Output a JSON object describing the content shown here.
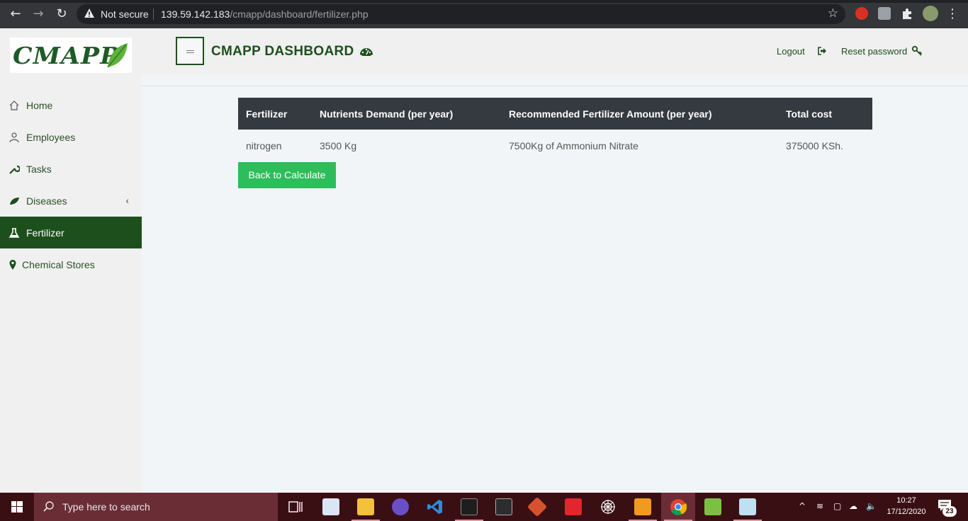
{
  "browser": {
    "security_label": "Not secure",
    "url_host": "139.59.142.183",
    "url_path": "/cmapp/dashboard/fertilizer.php"
  },
  "sidebar": {
    "logo_text": "CMAPP",
    "items": [
      {
        "label": "Home",
        "icon": "home-icon"
      },
      {
        "label": "Employees",
        "icon": "user-icon"
      },
      {
        "label": "Tasks",
        "icon": "wrench-icon"
      },
      {
        "label": "Diseases",
        "icon": "leaf-icon"
      },
      {
        "label": "Fertilizer",
        "icon": "flask-icon",
        "active": true
      },
      {
        "label": "Chemical Stores",
        "icon": "map-marker-icon"
      }
    ]
  },
  "header": {
    "title": "CMAPP DASHBOARD",
    "logout_label": "Logout",
    "reset_label": "Reset password"
  },
  "table": {
    "columns": [
      "Fertilizer",
      "Nutrients Demand (per year)",
      "Recommended Fertilizer Amount (per year)",
      "Total cost"
    ],
    "rows": [
      [
        "nitrogen",
        "3500 Kg",
        "7500Kg of Ammonium Nitrate",
        "375000 KSh."
      ]
    ]
  },
  "back_button_label": "Back to Calculate",
  "taskbar": {
    "search_placeholder": "Type here to search",
    "time": "10:27",
    "date": "17/12/2020",
    "notification_count": "23"
  },
  "colors": {
    "brand_green": "#1d4f1c",
    "button_green": "#2dbd5a",
    "table_header": "#343a40",
    "taskbar": "#3a0f14"
  }
}
